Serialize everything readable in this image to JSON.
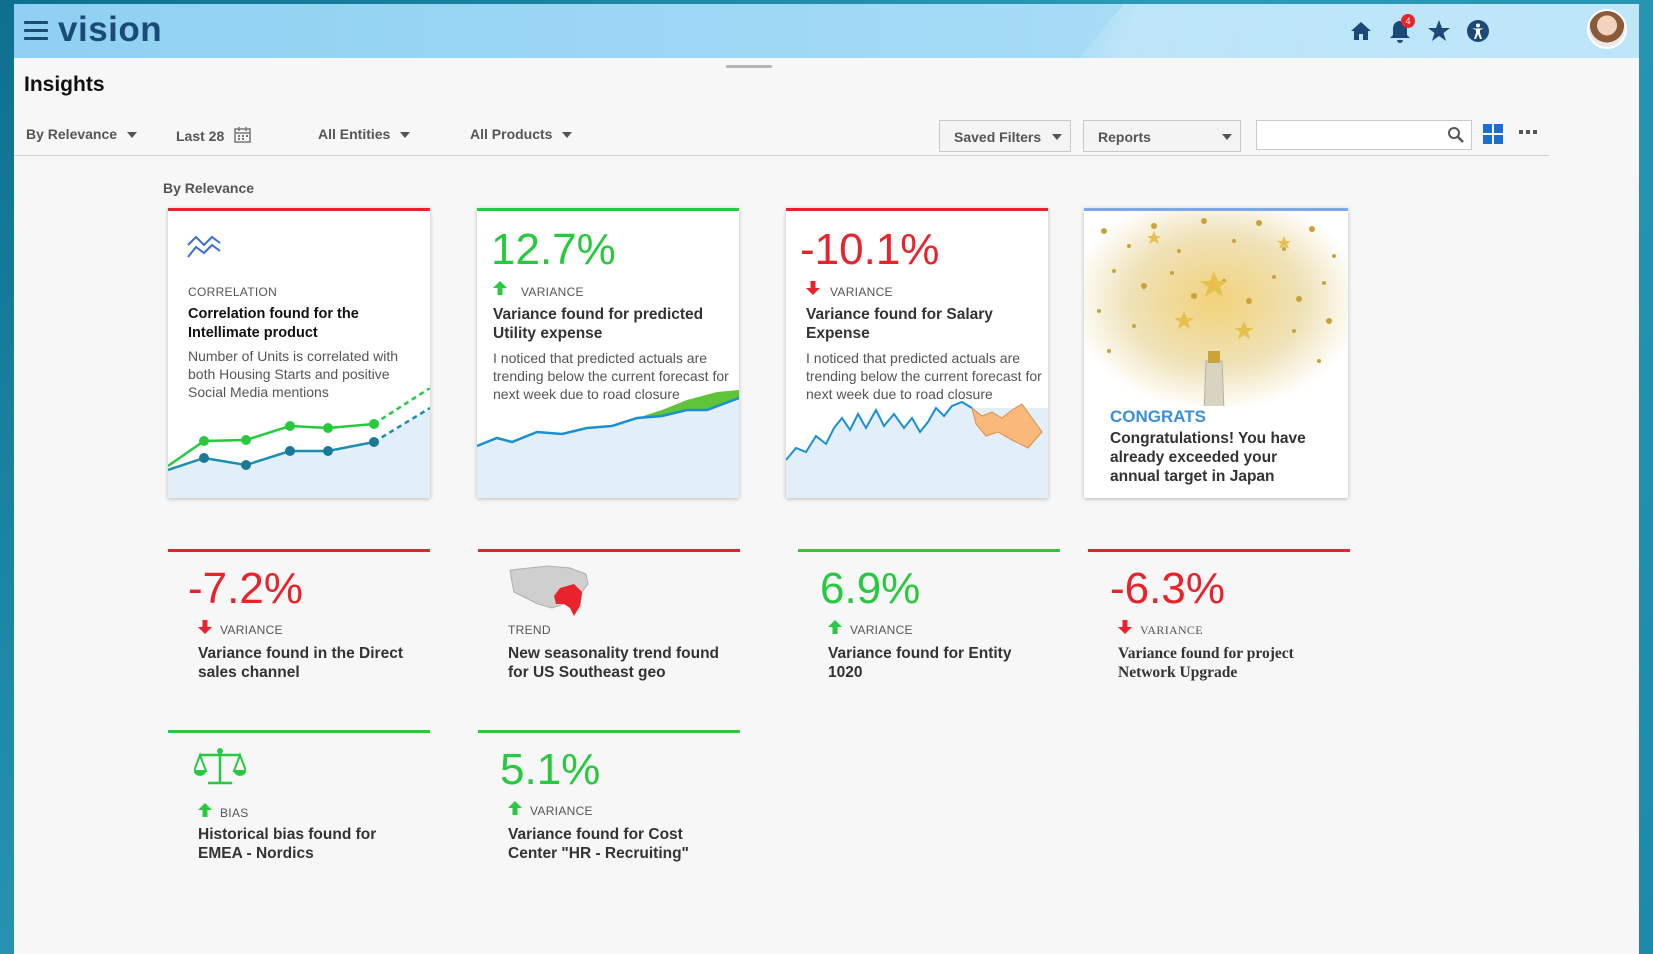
{
  "header": {
    "logo": "vision",
    "notification_count": "4",
    "icons": [
      "home-icon",
      "bell-icon",
      "star-icon",
      "accessibility-icon"
    ]
  },
  "page": {
    "title": "Insights"
  },
  "filters": {
    "relevance": "By Relevance",
    "period": "Last 28",
    "entities": "All Entities",
    "products": "All Products",
    "saved_filters": "Saved Filters",
    "reports": "Reports",
    "search_value": ""
  },
  "section_label": "By Relevance",
  "colors": {
    "red": "#e8232b",
    "green": "#27c93f",
    "blue": "#7fa7e8",
    "header": "#a3daf6"
  },
  "cards": [
    {
      "category": "CORRELATION",
      "title": "Correlation found for the Intellimate product",
      "description": "Number of Units is correlated with both Housing Starts and positive Social Media mentions"
    },
    {
      "value": "12.7%",
      "category": "VARIANCE",
      "title": "Variance found for predicted Utility expense",
      "description": "I noticed that predicted actuals are trending below the current forecast for next week due to road closure"
    },
    {
      "value": "-10.1%",
      "category": "VARIANCE",
      "title": "Variance found for Salary Expense",
      "description": "I noticed that predicted actuals are trending below the current forecast for next week due to road closure"
    },
    {
      "category": "CONGRATS",
      "title": "Congratulations! You have already exceeded your annual target in Japan"
    }
  ],
  "tiles": [
    {
      "value": "-7.2%",
      "category": "VARIANCE",
      "title": "Variance found in the Direct sales channel"
    },
    {
      "category": "TREND",
      "title": "New seasonality trend found for US Southeast geo"
    },
    {
      "value": "6.9%",
      "category": "VARIANCE",
      "title": "Variance found for Entity 1020"
    },
    {
      "value": "-6.3%",
      "category": "VARIANCE",
      "title": "Variance found for project Network Upgrade"
    },
    {
      "category": "BIAS",
      "title": "Historical bias found for EMEA - Nordics"
    },
    {
      "value": "5.1%",
      "category": "VARIANCE",
      "title": "Variance found for Cost Center \"HR - Recruiting\""
    }
  ]
}
